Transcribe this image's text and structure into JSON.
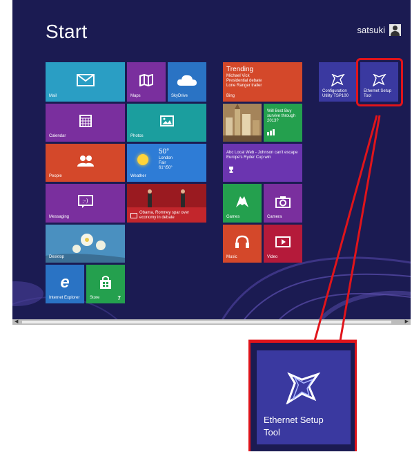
{
  "screen": {
    "title": "Start",
    "user_name": "satsuki"
  },
  "tiles": {
    "mail": "Mail",
    "maps": "Maps",
    "skydrive": "SkyDrive",
    "calendar": "Calendar",
    "photos": "Photos",
    "people": "People",
    "weather": {
      "label": "Weather",
      "temp": "50°",
      "city": "London",
      "condition": "Fair",
      "range": "61°/50°"
    },
    "messaging": "Messaging",
    "news": "Obama, Romney spar over economy in debate",
    "desktop": "Desktop",
    "ie": "Internet Explorer",
    "store": {
      "label": "Store",
      "count": "7"
    },
    "bing": {
      "heading": "Trending",
      "items": [
        "Michael Vick",
        "Presidential debate",
        "Lone Ranger trailer"
      ],
      "label": "Bing"
    },
    "finance": "Will Best Buy survive through 2013?",
    "sports": "Abc Local Web - Johnson can't escape Europe's Ryder Cup win",
    "games": "Games",
    "camera": "Camera",
    "music": "Music",
    "video": "Video",
    "config_utility": "Configuration Utility TSP100",
    "ethernet_setup": "Ethernet Setup Tool"
  },
  "zoom": {
    "label": "Ethernet Setup Tool"
  },
  "colors": {
    "background": "#1b1b52",
    "highlight": "#e0141b",
    "tile_teal": "#2a9ec4",
    "tile_purple": "#7a2f9e",
    "tile_orange": "#d4482a",
    "tile_green": "#24a04e",
    "tile_blue": "#3b6fc7",
    "tile_app": "#3a39a0"
  }
}
